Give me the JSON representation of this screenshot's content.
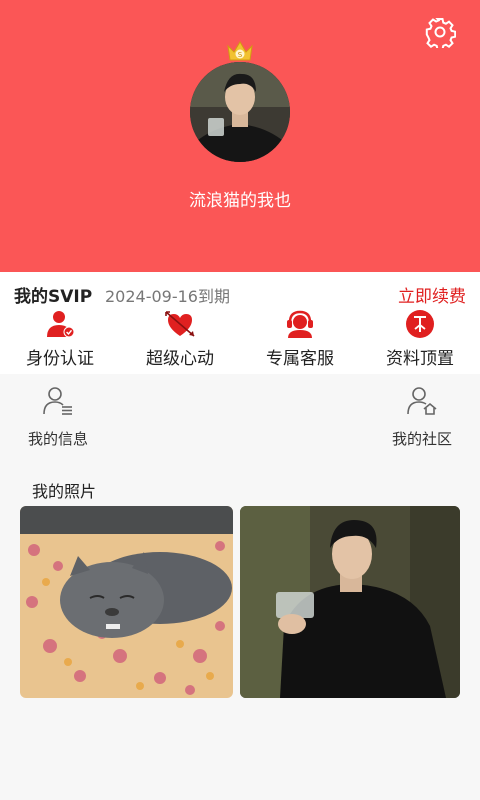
{
  "profile": {
    "nickname": "流浪猫的我也",
    "crown_letter": "S"
  },
  "svip": {
    "title": "我的SVIP",
    "expiry": "2024-09-16到期",
    "renew_label": "立即续费"
  },
  "features": [
    {
      "label": "身份认证",
      "icon": "verified-user-icon"
    },
    {
      "label": "超级心动",
      "icon": "heart-arrow-icon"
    },
    {
      "label": "专属客服",
      "icon": "headset-icon"
    },
    {
      "label": "资料顶置",
      "icon": "pin-top-icon"
    }
  ],
  "links": [
    {
      "label": "我的信息",
      "icon": "user-info-icon"
    },
    {
      "label": "我的社区",
      "icon": "user-community-icon"
    }
  ],
  "photos": {
    "title": "我的照片"
  },
  "colors": {
    "header": "#fb5656",
    "accent": "#e02020"
  }
}
